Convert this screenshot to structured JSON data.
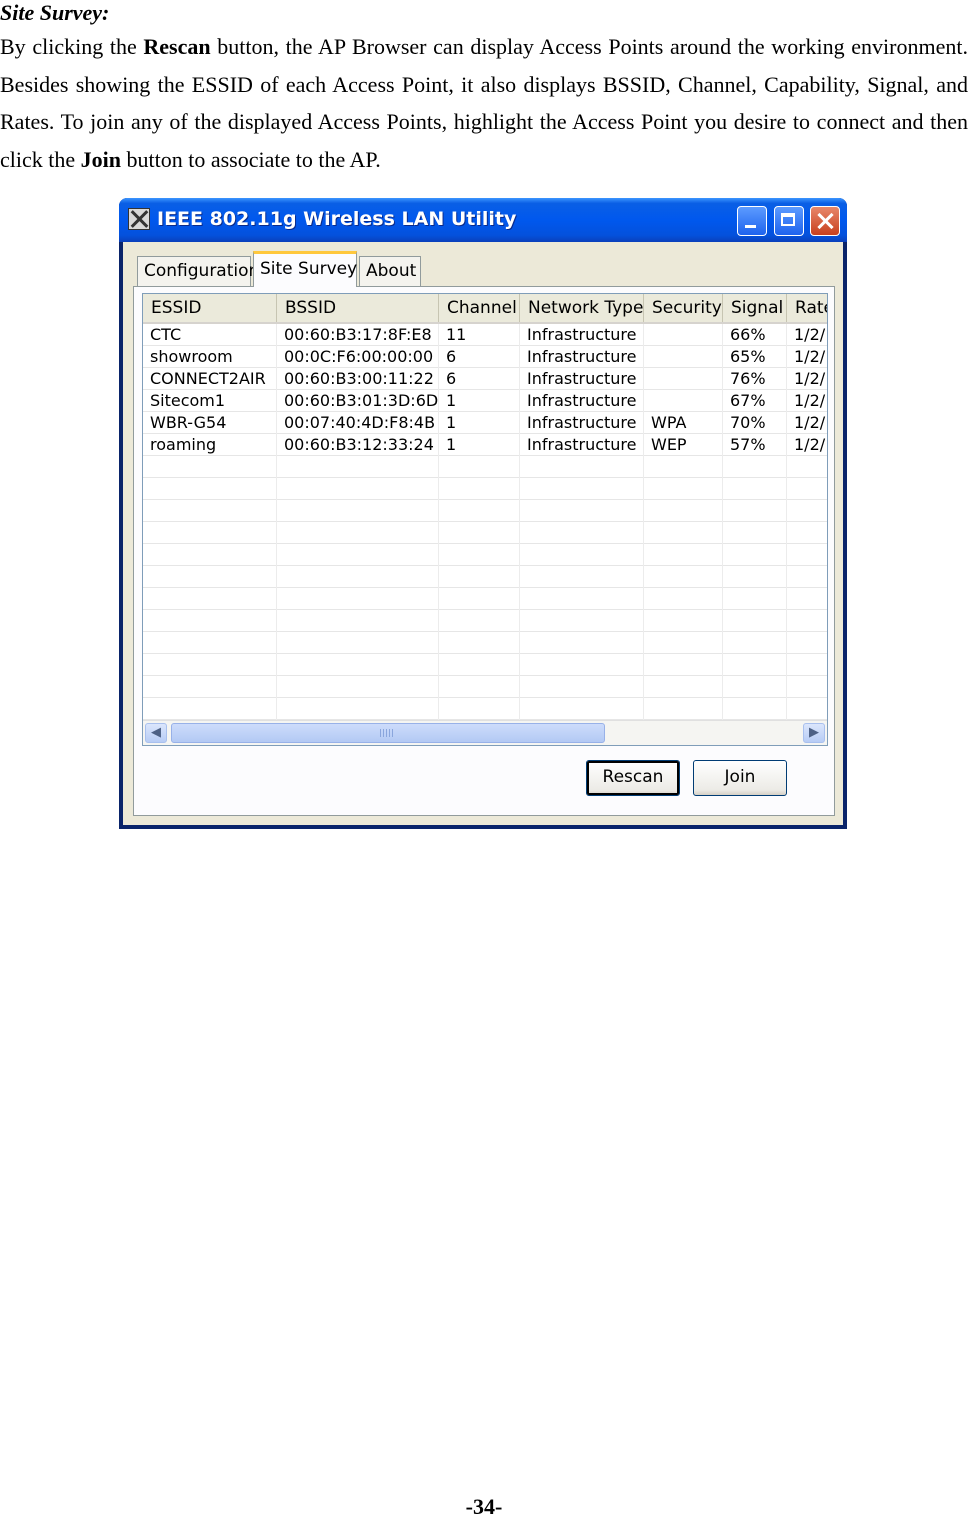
{
  "doc": {
    "heading": "Site Survey:",
    "para": {
      "p1": "By clicking the ",
      "b1": "Rescan",
      "p2": " button, the AP Browser can display Access Points around the working environment. Besides showing the ESSID of each Access Point, it also displays BSSID, Channel, Capability, Signal, and Rates. To join any of the displayed Access Points, highlight the Access Point you desire to connect and then click the ",
      "b2": "Join",
      "p3": " button to associate to the AP."
    },
    "page_number": "-34-"
  },
  "window": {
    "title": "IEEE 802.11g Wireless LAN Utility",
    "tabs": [
      "Configuration",
      "Site Survey",
      "About"
    ],
    "active_tab": "Site Survey",
    "columns": [
      "ESSID",
      "BSSID",
      "Channel",
      "Network Type",
      "Security",
      "Signal",
      "Rate"
    ],
    "rows": [
      [
        "CTC",
        "00:60:B3:17:8F:E8",
        "11",
        "Infrastructure",
        "",
        "66%",
        "1/2/"
      ],
      [
        "showroom",
        "00:0C:F6:00:00:00",
        "6",
        "Infrastructure",
        "",
        "65%",
        "1/2/"
      ],
      [
        "CONNECT2AIR",
        "00:60:B3:00:11:22",
        "6",
        "Infrastructure",
        "",
        "76%",
        "1/2/"
      ],
      [
        "Sitecom1",
        "00:60:B3:01:3D:6D",
        "1",
        "Infrastructure",
        "",
        "67%",
        "1/2/"
      ],
      [
        "WBR-G54",
        "00:07:40:4D:F8:4B",
        "1",
        "Infrastructure",
        "WPA",
        "70%",
        "1/2/"
      ],
      [
        "roaming",
        "00:60:B3:12:33:24",
        "1",
        "Infrastructure",
        "WEP",
        "57%",
        "1/2/"
      ]
    ],
    "buttons": {
      "rescan": "Rescan",
      "join": "Join"
    },
    "icons": {
      "app": "app-icon",
      "minimize": "minimize-icon",
      "maximize": "maximize-icon",
      "close": "close-icon",
      "scroll_left": "scroll-left-icon",
      "scroll_right": "scroll-right-icon"
    }
  }
}
